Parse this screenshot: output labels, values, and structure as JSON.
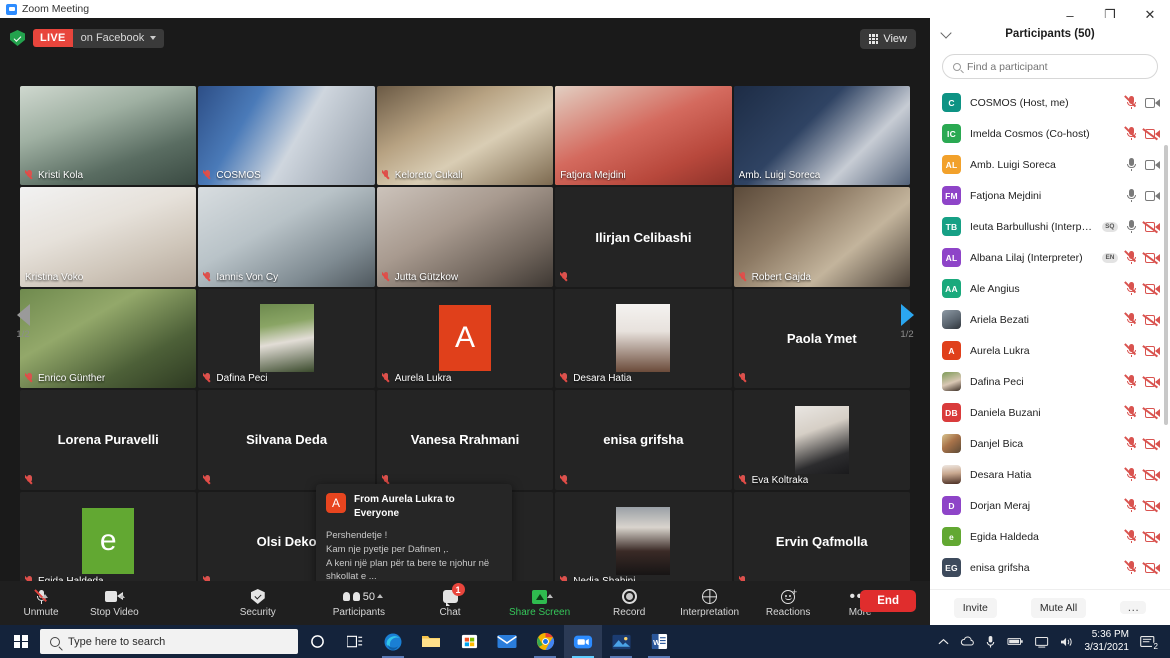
{
  "window": {
    "title": "Zoom Meeting",
    "minimize": "–",
    "maximize": "❐",
    "close": "✕"
  },
  "topbar": {
    "live_label": "LIVE",
    "platform": "on Facebook",
    "view_label": "View"
  },
  "grid": {
    "page_left": "1/2",
    "page_right": "1/2",
    "tiles": [
      {
        "name": "Kristi Kola",
        "kind": "video",
        "muted": true,
        "active": false,
        "cam": "linear-gradient(160deg,#cfd8cf 0%,#9fb0a2 35%,#5a6d62 70%,#3a4a42 100%)"
      },
      {
        "name": "COSMOS",
        "kind": "video",
        "muted": true,
        "active": false,
        "cam": "linear-gradient(120deg,#2d4e86 0%,#4a7ab8 28%,#cfd6de 55%,#8f9aa6 100%)"
      },
      {
        "name": "Keloreto Cukali",
        "kind": "video",
        "muted": true,
        "active": false,
        "cam": "linear-gradient(150deg,#6b5a45 0%,#b7a282 35%,#d9cdb4 60%,#7d6a50 100%)"
      },
      {
        "name": "Fatjora Mejdini",
        "kind": "video",
        "muted": false,
        "active": true,
        "cam": "linear-gradient(155deg,#e2cfc2 0%,#d46a5e 45%,#b8483c 75%,#8d3229 100%)"
      },
      {
        "name": "Amb. Luigi Soreca",
        "kind": "video",
        "muted": false,
        "active": false,
        "cam": "linear-gradient(135deg,#1d2c45 0%,#2f4363 40%,#c7ccd4 70%,#54637a 100%)"
      },
      {
        "name": "Kristina Voko",
        "kind": "video",
        "muted": false,
        "active": false,
        "cam": "linear-gradient(160deg,#f2f2f2 0%,#e6e1da 40%,#cfc6ba 70%,#b4a79a 100%)"
      },
      {
        "name": "Iannis Von Cy",
        "kind": "video",
        "muted": true,
        "active": false,
        "cam": "linear-gradient(150deg,#d8dde0 0%,#b9c3c8 40%,#7f8b92 75%,#4f585e 100%)"
      },
      {
        "name": "Jutta Gützkow",
        "kind": "video",
        "muted": true,
        "active": false,
        "cam": "linear-gradient(150deg,#ccc3bb 0%,#a89a8f 40%,#6f645b 75%,#3e3833 100%)"
      },
      {
        "name": "Ilirjan Celibashi",
        "kind": "name",
        "muted": true,
        "active": false,
        "cam": ""
      },
      {
        "name": "Robert Gajda",
        "kind": "video",
        "muted": true,
        "active": false,
        "cam": "linear-gradient(140deg,#5b4a3a 0%,#8d7a64 35%,#c3b49c 65%,#4b4138 100%)"
      },
      {
        "name": "Enrico Günther",
        "kind": "video",
        "muted": true,
        "active": false,
        "cam": "linear-gradient(150deg,#6f8a4e 0%,#93a86a 35%,#4d6038 70%,#2e3a22 100%)"
      },
      {
        "name": "Dafina Peci",
        "kind": "photo",
        "muted": true,
        "active": false,
        "photo": "linear-gradient(170deg,#6d8a4e 0%,#8aa565 30%,#e2ddd6 55%,#3a4a2c 100%)"
      },
      {
        "name": "Aurela Lukra",
        "kind": "letter",
        "muted": true,
        "active": false,
        "letter": "A",
        "color": "#e0401b"
      },
      {
        "name": "Desara Hatia",
        "kind": "photo",
        "muted": true,
        "active": false,
        "photo": "linear-gradient(180deg,#f4f2f0 0%,#e8e2dd 40%,#6b4b3a 100%)"
      },
      {
        "name": "Paola Ymet",
        "kind": "name",
        "muted": true,
        "active": false,
        "cam": ""
      },
      {
        "name": "Lorena Puravelli",
        "kind": "name",
        "muted": true,
        "active": false,
        "cam": ""
      },
      {
        "name": "Silvana Deda",
        "kind": "name",
        "muted": true,
        "active": false,
        "cam": ""
      },
      {
        "name": "Vanesa Rrahmani",
        "kind": "name",
        "muted": true,
        "active": false,
        "cam": ""
      },
      {
        "name": "enisa grifsha",
        "kind": "name",
        "muted": true,
        "active": false,
        "cam": ""
      },
      {
        "name": "Eva Koltraka",
        "kind": "photo",
        "muted": true,
        "active": false,
        "photo": "linear-gradient(160deg,#e9e6e2 0%,#d6cfc6 35%,#2c2c2e 75%,#1a1a1c 100%)"
      },
      {
        "name": "Egida Haldeda",
        "kind": "letter",
        "muted": true,
        "active": false,
        "letter": "e",
        "color": "#62a832"
      },
      {
        "name": "Olsi Deko",
        "kind": "name",
        "muted": true,
        "active": false,
        "cam": ""
      },
      {
        "name": "",
        "kind": "blank",
        "muted": false,
        "active": false,
        "cam": ""
      },
      {
        "name": "Nedia Shahini",
        "kind": "photo",
        "muted": true,
        "active": false,
        "photo": "linear-gradient(180deg,#9aa0a6 0%,#d9d4cd 30%,#3a2a26 65%,#171515 100%)"
      },
      {
        "name": "Ervin Qafmolla",
        "kind": "name",
        "muted": true,
        "active": false,
        "cam": ""
      }
    ]
  },
  "chat_toast": {
    "avatar_letter": "A",
    "from": "From Aurela Lukra to Everyone",
    "message": "Pershendetje !\nKam nje pyetje per Dafinen ,.\nA keni një plan për ta bere te njohur në shkollat e ..."
  },
  "toolbar": {
    "unmute": "Unmute",
    "stop_video": "Stop Video",
    "security": "Security",
    "participants": "Participants",
    "participants_count": "50",
    "chat": "Chat",
    "chat_badge": "1",
    "share_screen": "Share Screen",
    "record": "Record",
    "interpretation": "Interpretation",
    "reactions": "Reactions",
    "more": "More",
    "end": "End"
  },
  "participants_panel": {
    "title": "Participants (50)",
    "search_placeholder": "Find a participant",
    "invite": "Invite",
    "mute_all": "Mute All",
    "more": "…",
    "items": [
      {
        "name": "COSMOS (Host, me)",
        "initials": "C",
        "color": "#0e9384",
        "mic": "off",
        "cam": "on",
        "lang": ""
      },
      {
        "name": "Imelda Cosmos (Co-host)",
        "initials": "IC",
        "color": "#2aa952",
        "mic": "off",
        "cam": "off",
        "lang": ""
      },
      {
        "name": "Amb. Luigi Soreca",
        "initials": "AL",
        "color": "#f2a12b",
        "mic": "on",
        "cam": "on",
        "lang": ""
      },
      {
        "name": "Fatjona Mejdini",
        "initials": "FM",
        "color": "#8e44c8",
        "mic": "on",
        "cam": "on",
        "lang": ""
      },
      {
        "name": "Ieuta Barbullushi (Interpreter)",
        "initials": "TB",
        "color": "#16a085",
        "mic": "on",
        "cam": "off",
        "lang": "SQ"
      },
      {
        "name": "Albana Lilaj (Interpreter)",
        "initials": "AL",
        "color": "#8e44c8",
        "mic": "off",
        "cam": "off",
        "lang": "EN"
      },
      {
        "name": "Ale Angius",
        "initials": "AA",
        "color": "#1aa97c",
        "mic": "off",
        "cam": "off",
        "lang": ""
      },
      {
        "name": "Ariela Bezati",
        "initials": "",
        "color": "#6b7280",
        "mic": "off",
        "cam": "off",
        "lang": "",
        "photo": "linear-gradient(150deg,#8e9aa5 0%,#59636d 60%,#2e3339 100%)"
      },
      {
        "name": "Aurela Lukra",
        "initials": "A",
        "color": "#e0401b",
        "mic": "off",
        "cam": "off",
        "lang": ""
      },
      {
        "name": "Dafina Peci",
        "initials": "",
        "color": "#5a7040",
        "mic": "off",
        "cam": "off",
        "lang": "",
        "photo": "linear-gradient(160deg,#7d9b57 0%,#d9c7b4 55%,#3c2f26 100%)"
      },
      {
        "name": "Daniela Buzani",
        "initials": "DB",
        "color": "#d93b3b",
        "mic": "off",
        "cam": "off",
        "lang": ""
      },
      {
        "name": "Danjel Bica",
        "initials": "",
        "color": "#b08a5e",
        "mic": "off",
        "cam": "off",
        "lang": "",
        "photo": "linear-gradient(140deg,#d9c48f 0%,#a8734a 45%,#5c4a36 100%)"
      },
      {
        "name": "Desara Hatia",
        "initials": "",
        "color": "#6b4b3a",
        "mic": "off",
        "cam": "off",
        "lang": "",
        "photo": "linear-gradient(175deg,#efe8e2 0%,#c9a88f 45%,#4a2f24 100%)"
      },
      {
        "name": "Dorjan Meraj",
        "initials": "D",
        "color": "#8e44c8",
        "mic": "off",
        "cam": "off",
        "lang": ""
      },
      {
        "name": "Egida Haldeda",
        "initials": "e",
        "color": "#62a832",
        "mic": "off",
        "cam": "off",
        "lang": ""
      },
      {
        "name": "enisa grifsha",
        "initials": "EG",
        "color": "#3d4a5c",
        "mic": "off",
        "cam": "off",
        "lang": ""
      }
    ]
  },
  "taskbar": {
    "search_placeholder": "Type here to search",
    "time": "5:36 PM",
    "date": "3/31/2021",
    "notification_count": "2"
  }
}
